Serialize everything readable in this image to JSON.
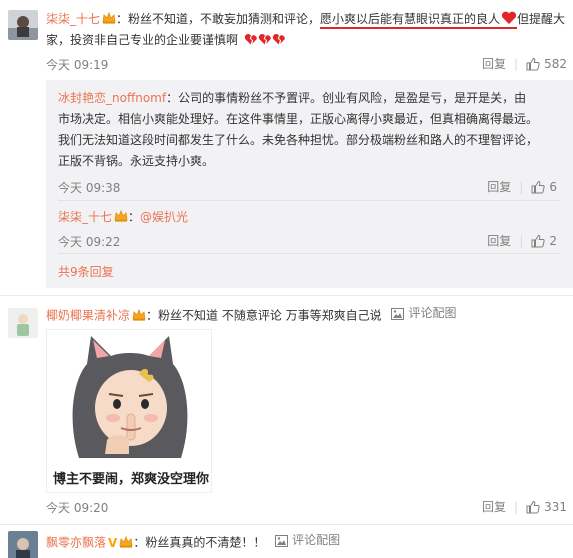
{
  "c1": {
    "username": "柒柒_十七",
    "text_before": "：粉丝不知道，不敢妄加猜测和评论，",
    "text_highlight": "愿小爽以后能有慧眼识真正的良人",
    "text_after": "但提醒大家，投资非自己专业的企业要谨慎啊",
    "time": "今天 09:19",
    "reply_label": "回复",
    "like_count": "582"
  },
  "r1": {
    "username": "冰封艳恋_noffnomf",
    "text": "：公司的事情粉丝不予置评。创业有风险，是盈是亏，是开是关，由市场决定。相信小爽能处理好。在这件事情里，正版心离得小爽最近，但真相确离得最远。我们无法知道这段时间都发生了什么。未免各种担忧。部分极端粉丝和路人的不理智评论，正版不背锅。永远支持小爽。",
    "time": "今天 09:38",
    "reply_label": "回复",
    "like_count": "6"
  },
  "r2": {
    "username": "柒柒_十七",
    "text_prefix": "：",
    "mention": "@娱扒光",
    "time": "今天 09:22",
    "reply_label": "回复",
    "like_count": "2"
  },
  "more_replies": "共9条回复",
  "c2": {
    "username": "椰奶椰果清补凉",
    "text": "：粉丝不知道 不随意评论 万事等郑爽自己说",
    "pic_comment": "评论配图",
    "meme_caption": "博主不要闹，郑爽没空理你",
    "time": "今天 09:20",
    "reply_label": "回复",
    "like_count": "331"
  },
  "c3": {
    "username": "飘零亦飘落",
    "v_badge": "V",
    "text": "：粉丝真真的不清楚！！",
    "pic_comment": "评论配图"
  },
  "colors": {
    "username": "#eb7350",
    "underline": "#e0262b",
    "reply_bg": "#f2f2f5",
    "meta": "#808080"
  },
  "icons": [
    "user-avatar",
    "crown-badge-icon",
    "heart-icon",
    "broken-heart-icon",
    "thumbs-up-icon",
    "image-icon",
    "v-badge"
  ]
}
